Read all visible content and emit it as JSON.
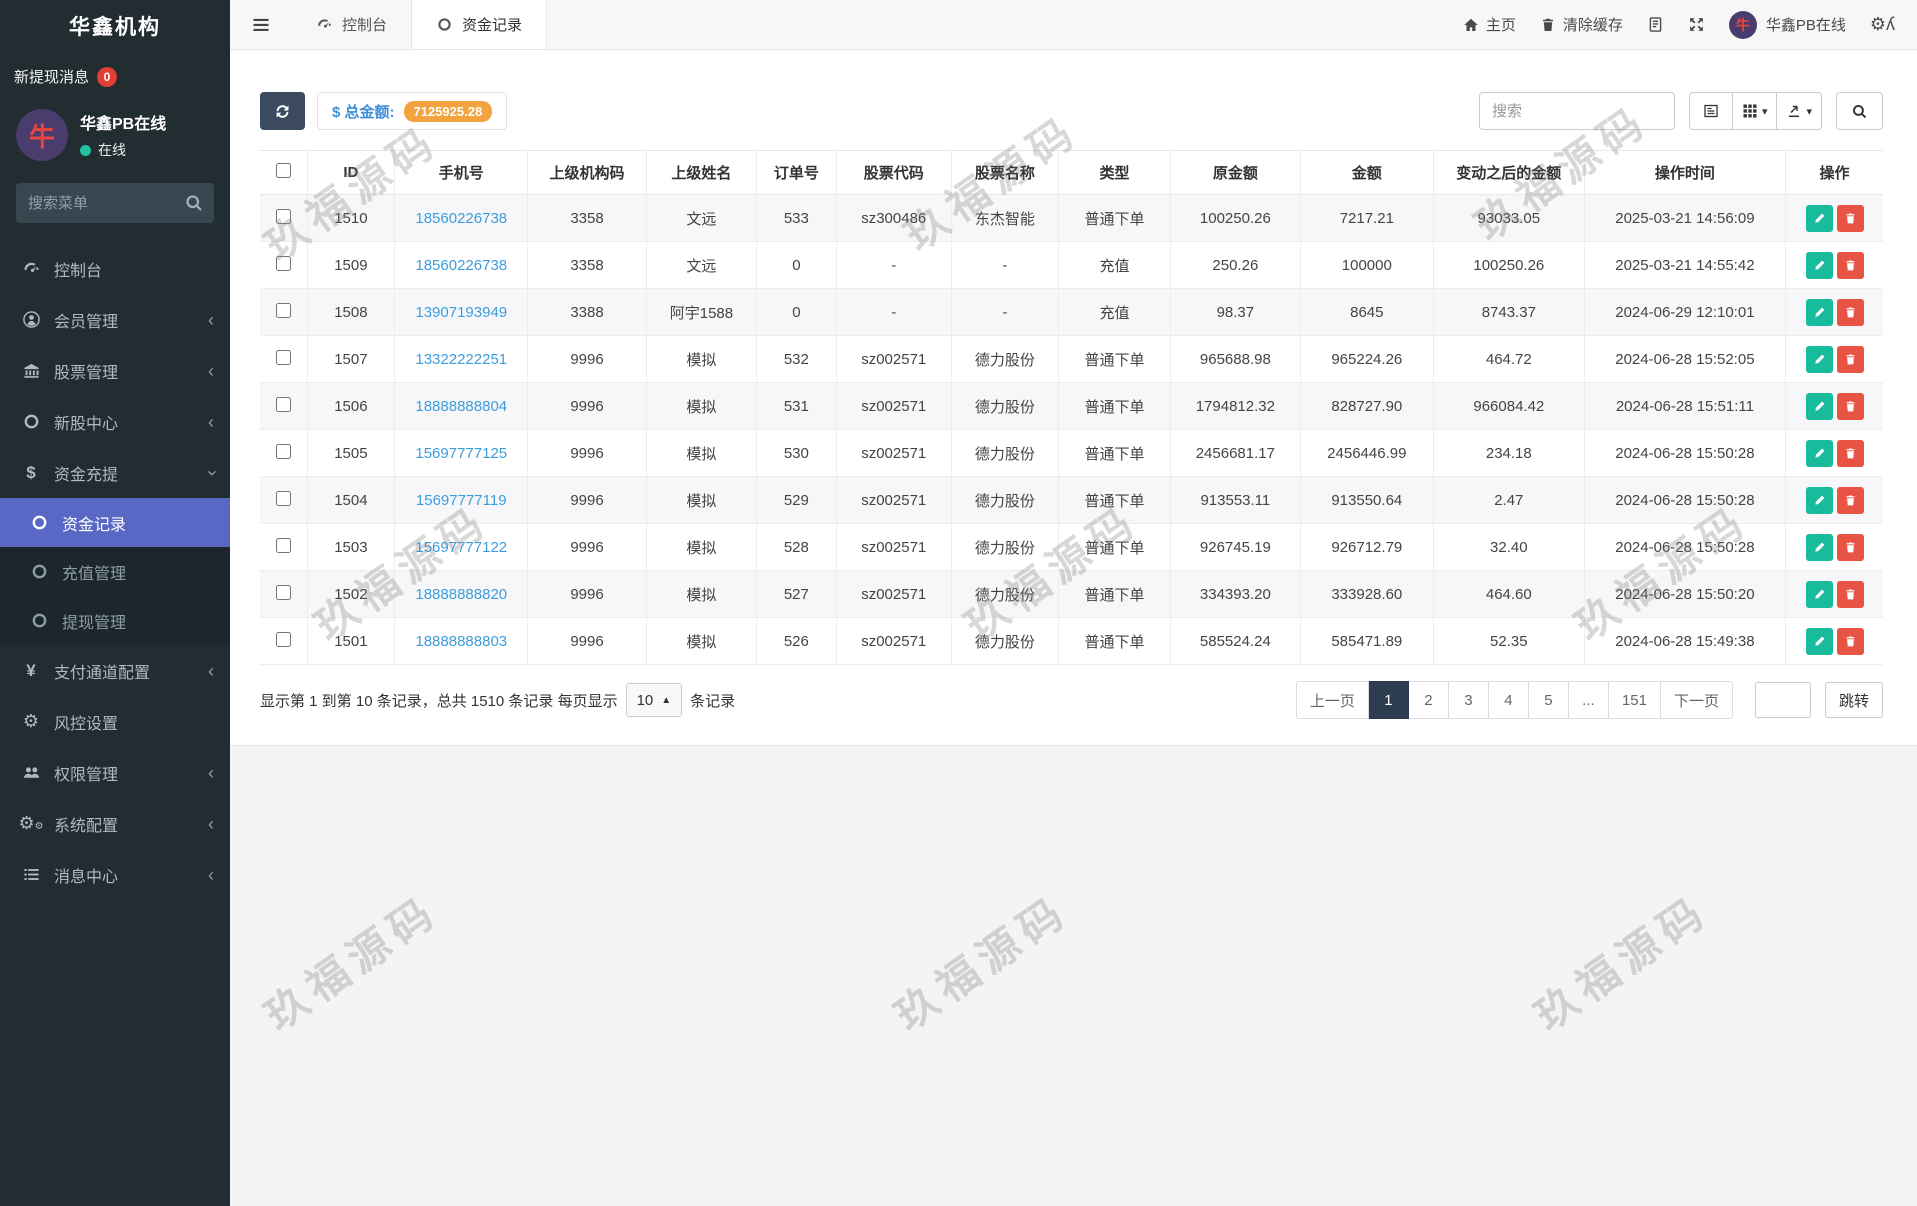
{
  "colors": {
    "sidebar_bg": "#222d32",
    "submenu_bg": "#1d262c",
    "active_menu": "#5968c5",
    "teal": "#18bc9c",
    "red": "#e95343",
    "orange_badge": "#f0a33f",
    "navy": "#2c3e50",
    "link_blue": "#3c9ddd",
    "total_blue": "#3e8fd8",
    "online_green": "#23c0a0"
  },
  "sidebar": {
    "title": "华鑫机构",
    "notice_label": "新提现消息",
    "notice_count": "0",
    "user": {
      "name": "华鑫PB在线",
      "status": "在线"
    },
    "search_placeholder": "搜索菜单",
    "menu": [
      {
        "name": "dashboard",
        "icon": "gauge",
        "label": "控制台",
        "chevron": ""
      },
      {
        "name": "members",
        "icon": "person",
        "label": "会员管理",
        "chevron": "left"
      },
      {
        "name": "stocks",
        "icon": "bank",
        "label": "股票管理",
        "chevron": "left"
      },
      {
        "name": "ipo-center",
        "icon": "circle",
        "label": "新股中心",
        "chevron": "left"
      },
      {
        "name": "funds",
        "icon": "dollar",
        "label": "资金充提",
        "chevron": "down",
        "children": [
          {
            "name": "fund-records",
            "icon": "circle",
            "label": "资金记录",
            "active": true
          },
          {
            "name": "recharge-mgmt",
            "icon": "circle",
            "label": "充值管理"
          },
          {
            "name": "withdraw-mgmt",
            "icon": "circle",
            "label": "提现管理"
          }
        ]
      },
      {
        "name": "pay-channel",
        "icon": "yen",
        "label": "支付通道配置",
        "chevron": "left"
      },
      {
        "name": "risk-settings",
        "icon": "gear",
        "label": "风控设置",
        "chevron": ""
      },
      {
        "name": "permissions",
        "icon": "users",
        "label": "权限管理",
        "chevron": "left"
      },
      {
        "name": "system-config",
        "icon": "cogs",
        "label": "系统配置",
        "chevron": "left"
      },
      {
        "name": "message-center",
        "icon": "list",
        "label": "消息中心",
        "chevron": "left"
      }
    ]
  },
  "topbar": {
    "tabs": [
      {
        "name": "tab-dashboard",
        "icon": "gauge",
        "label": "控制台",
        "active": false
      },
      {
        "name": "tab-fund-records",
        "icon": "circle",
        "label": "资金记录",
        "active": true
      }
    ],
    "home_label": "主页",
    "clear_cache_label": "清除缓存",
    "user_name": "华鑫PB在线"
  },
  "toolbar": {
    "total_label": "$ 总金额:",
    "total_value": "7125925.28",
    "search_placeholder": "搜索"
  },
  "table": {
    "columns": [
      "ID",
      "手机号",
      "上级机构码",
      "上级姓名",
      "订单号",
      "股票代码",
      "股票名称",
      "类型",
      "原金额",
      "金额",
      "变动之后的金额",
      "操作时间",
      "操作"
    ],
    "rows": [
      {
        "id": "1510",
        "phone": "18560226738",
        "org": "3358",
        "parent": "文远",
        "order": "533",
        "code": "sz300486",
        "stock": "东杰智能",
        "type": "普通下单",
        "orig": "100250.26",
        "amount": "7217.21",
        "after": "93033.05",
        "time": "2025-03-21 14:56:09"
      },
      {
        "id": "1509",
        "phone": "18560226738",
        "org": "3358",
        "parent": "文远",
        "order": "0",
        "code": "-",
        "stock": "-",
        "type": "充值",
        "orig": "250.26",
        "amount": "100000",
        "after": "100250.26",
        "time": "2025-03-21 14:55:42"
      },
      {
        "id": "1508",
        "phone": "13907193949",
        "org": "3388",
        "parent": "阿宇1588",
        "order": "0",
        "code": "-",
        "stock": "-",
        "type": "充值",
        "orig": "98.37",
        "amount": "8645",
        "after": "8743.37",
        "time": "2024-06-29 12:10:01"
      },
      {
        "id": "1507",
        "phone": "13322222251",
        "org": "9996",
        "parent": "模拟",
        "order": "532",
        "code": "sz002571",
        "stock": "德力股份",
        "type": "普通下单",
        "orig": "965688.98",
        "amount": "965224.26",
        "after": "464.72",
        "time": "2024-06-28 15:52:05"
      },
      {
        "id": "1506",
        "phone": "18888888804",
        "org": "9996",
        "parent": "模拟",
        "order": "531",
        "code": "sz002571",
        "stock": "德力股份",
        "type": "普通下单",
        "orig": "1794812.32",
        "amount": "828727.90",
        "after": "966084.42",
        "time": "2024-06-28 15:51:11"
      },
      {
        "id": "1505",
        "phone": "15697777125",
        "org": "9996",
        "parent": "模拟",
        "order": "530",
        "code": "sz002571",
        "stock": "德力股份",
        "type": "普通下单",
        "orig": "2456681.17",
        "amount": "2456446.99",
        "after": "234.18",
        "time": "2024-06-28 15:50:28"
      },
      {
        "id": "1504",
        "phone": "15697777119",
        "org": "9996",
        "parent": "模拟",
        "order": "529",
        "code": "sz002571",
        "stock": "德力股份",
        "type": "普通下单",
        "orig": "913553.11",
        "amount": "913550.64",
        "after": "2.47",
        "time": "2024-06-28 15:50:28"
      },
      {
        "id": "1503",
        "phone": "15697777122",
        "org": "9996",
        "parent": "模拟",
        "order": "528",
        "code": "sz002571",
        "stock": "德力股份",
        "type": "普通下单",
        "orig": "926745.19",
        "amount": "926712.79",
        "after": "32.40",
        "time": "2024-06-28 15:50:28"
      },
      {
        "id": "1502",
        "phone": "18888888820",
        "org": "9996",
        "parent": "模拟",
        "order": "527",
        "code": "sz002571",
        "stock": "德力股份",
        "type": "普通下单",
        "orig": "334393.20",
        "amount": "333928.60",
        "after": "464.60",
        "time": "2024-06-28 15:50:20"
      },
      {
        "id": "1501",
        "phone": "18888888803",
        "org": "9996",
        "parent": "模拟",
        "order": "526",
        "code": "sz002571",
        "stock": "德力股份",
        "type": "普通下单",
        "orig": "585524.24",
        "amount": "585471.89",
        "after": "52.35",
        "time": "2024-06-28 15:49:38"
      }
    ]
  },
  "footer": {
    "summary_prefix": "显示第 1 到第 10 条记录，总共 1510 条记录 每页显示",
    "page_size": "10",
    "summary_suffix": "条记录",
    "pages": [
      {
        "label": "上一页"
      },
      {
        "label": "1",
        "active": true
      },
      {
        "label": "2"
      },
      {
        "label": "3"
      },
      {
        "label": "4"
      },
      {
        "label": "5"
      },
      {
        "label": "..."
      },
      {
        "label": "151"
      },
      {
        "label": "下一页"
      }
    ],
    "jump_label": "跳转"
  },
  "watermark": {
    "text": "玖福源码"
  }
}
